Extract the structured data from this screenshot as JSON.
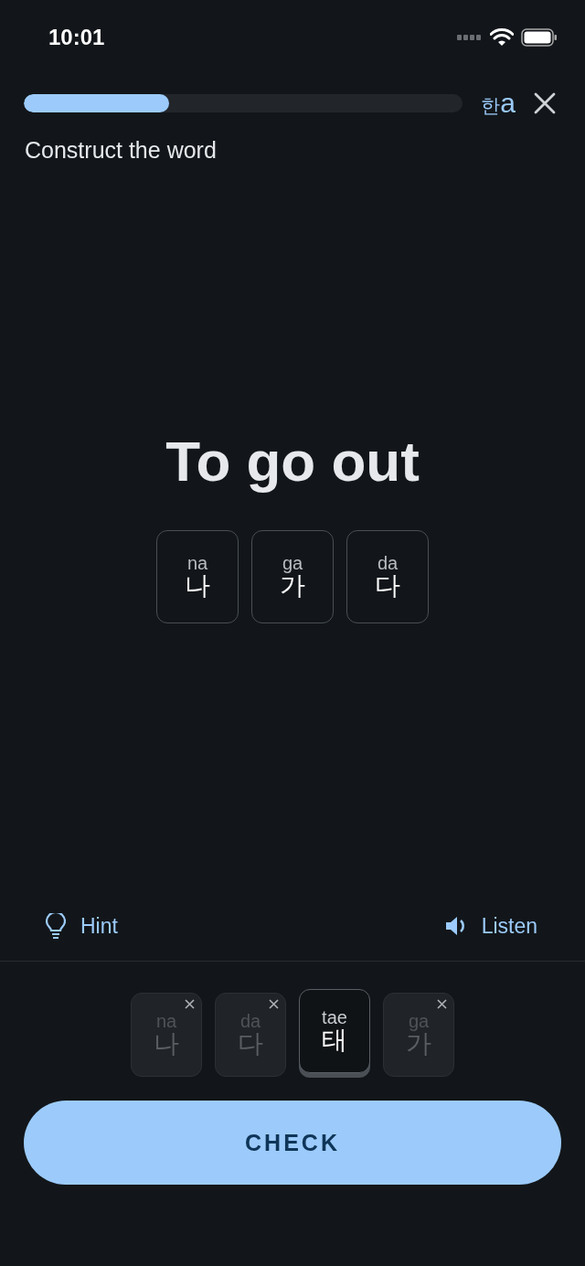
{
  "status_bar": {
    "time": "10:01"
  },
  "progress": {
    "level": 0.33
  },
  "script_toggle": {
    "hangul": "한",
    "latin": "a"
  },
  "instruction": "Construct the word",
  "prompt": "To go out",
  "answer_tiles": [
    {
      "romanization": "na",
      "syllable": "나"
    },
    {
      "romanization": "ga",
      "syllable": "가"
    },
    {
      "romanization": "da",
      "syllable": "다"
    }
  ],
  "actions": [
    {
      "kind": "hint",
      "label": "Hint"
    },
    {
      "kind": "listen",
      "label": "Listen"
    }
  ],
  "bank_tiles": [
    {
      "romanization": "na",
      "syllable": "나",
      "used": true
    },
    {
      "romanization": "da",
      "syllable": "다",
      "used": true
    },
    {
      "romanization": "tae",
      "syllable": "태",
      "used": false
    },
    {
      "romanization": "ga",
      "syllable": "가",
      "used": true
    }
  ],
  "check_button": "CHECK"
}
